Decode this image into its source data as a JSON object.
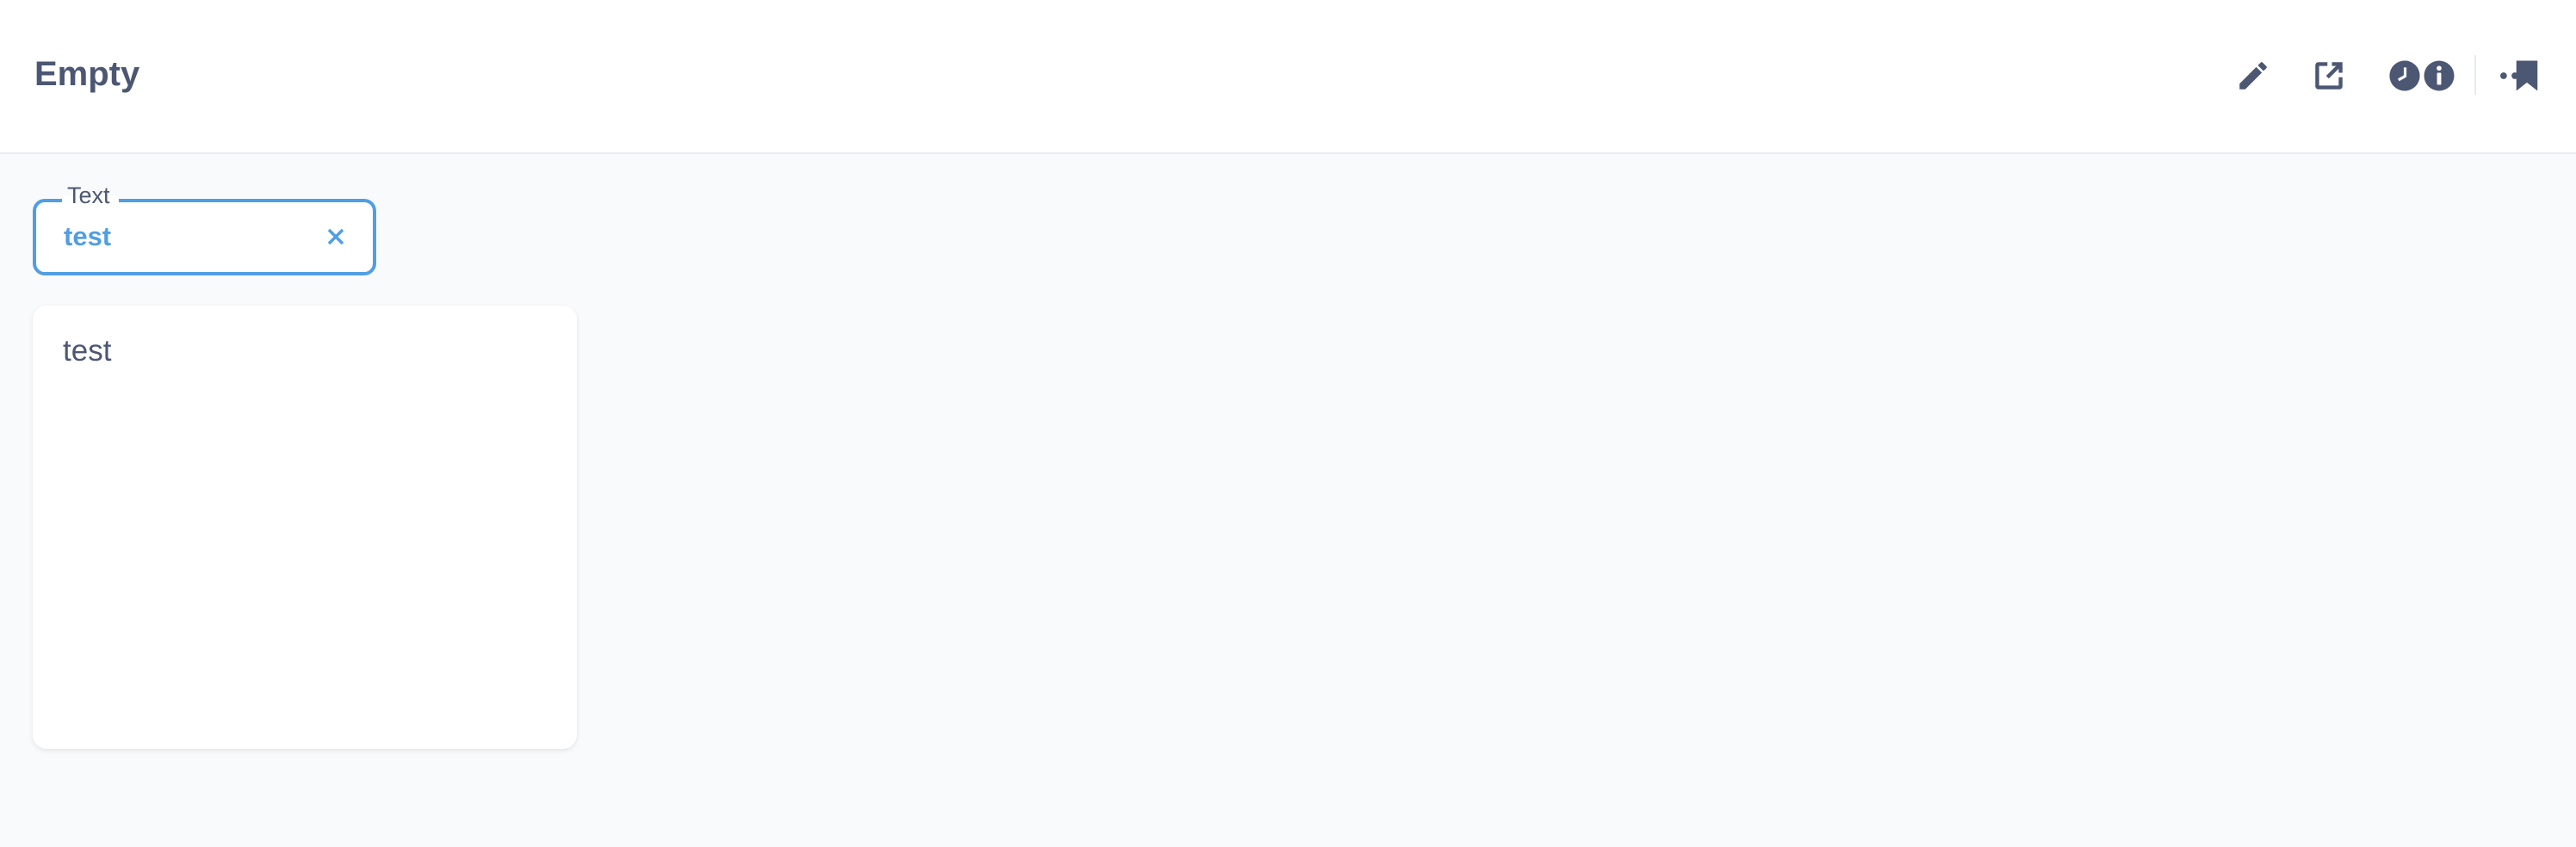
{
  "header": {
    "title": "Empty",
    "actions": [
      {
        "name": "edit",
        "icon": "pencil-icon"
      },
      {
        "name": "sharing",
        "icon": "share-external-icon"
      },
      {
        "name": "history",
        "icon": "clock-icon"
      },
      {
        "name": "bookmark",
        "icon": "bookmark-icon"
      },
      {
        "name": "info",
        "icon": "info-icon"
      },
      {
        "name": "more",
        "icon": "ellipsis-icon"
      }
    ]
  },
  "filter": {
    "label": "Text",
    "value": "test",
    "clear_icon": "close-icon",
    "accent_color": "#509ee3"
  },
  "card": {
    "text": "test"
  },
  "colors": {
    "text": "#4c5773",
    "background": "#f9fafc",
    "accent": "#509ee3"
  }
}
